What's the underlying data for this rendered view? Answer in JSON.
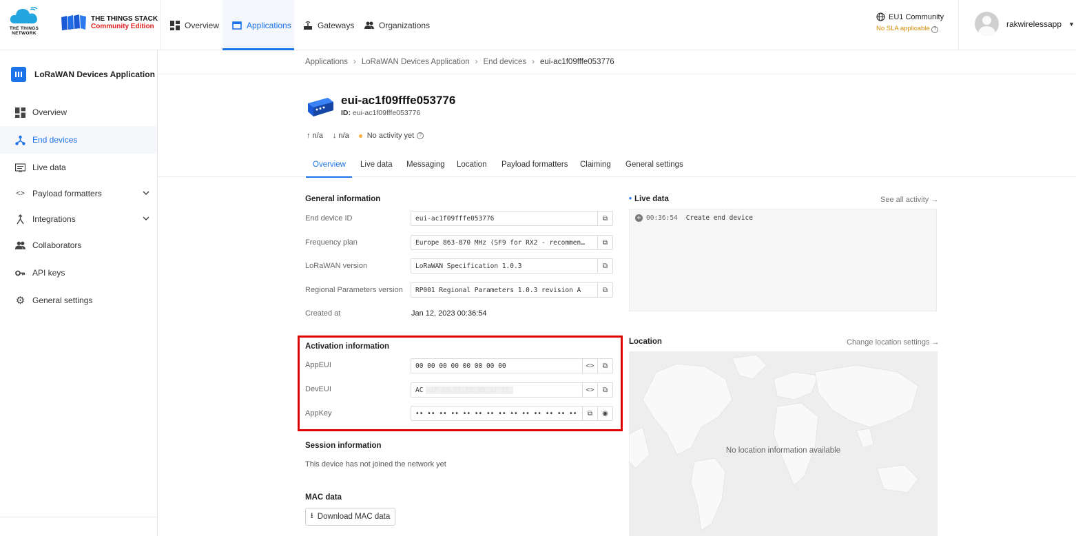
{
  "header": {
    "ttn_logo_text": "THE THINGS NETWORK",
    "tts_logo_line1": "THE THINGS STACK",
    "tts_logo_line2": "Community Edition",
    "nav": [
      {
        "label": "Overview",
        "icon": "dashboard-icon"
      },
      {
        "label": "Applications",
        "icon": "application-icon",
        "active": true
      },
      {
        "label": "Gateways",
        "icon": "gateway-icon"
      },
      {
        "label": "Organizations",
        "icon": "people-icon"
      }
    ],
    "cluster": "EU1 Community",
    "sla": "No SLA applicable",
    "username": "rakwirelessapp"
  },
  "sidebar": {
    "app_title": "LoRaWAN Devices Application",
    "items": [
      {
        "label": "Overview",
        "icon": "dashboard-icon"
      },
      {
        "label": "End devices",
        "icon": "device-hub-icon",
        "active": true
      },
      {
        "label": "Live data",
        "icon": "list-icon"
      },
      {
        "label": "Payload formatters",
        "icon": "code-icon",
        "expandable": true
      },
      {
        "label": "Integrations",
        "icon": "integration-icon",
        "expandable": true
      },
      {
        "label": "Collaborators",
        "icon": "people-icon"
      },
      {
        "label": "API keys",
        "icon": "key-icon"
      },
      {
        "label": "General settings",
        "icon": "gear-icon"
      }
    ]
  },
  "breadcrumb": [
    "Applications",
    "LoRaWAN Devices Application",
    "End devices",
    "eui-ac1f09fffe053776"
  ],
  "device": {
    "title": "eui-ac1f09fffe053776",
    "id_label": "ID:",
    "id_value": "eui-ac1f09fffe053776",
    "uplink": "n/a",
    "downlink": "n/a",
    "activity": "No activity yet"
  },
  "tabs": [
    "Overview",
    "Live data",
    "Messaging",
    "Location",
    "Payload formatters",
    "Claiming",
    "General settings"
  ],
  "general": {
    "title": "General information",
    "fields": [
      {
        "label": "End device ID",
        "value": "eui-ac1f09fffe053776"
      },
      {
        "label": "Frequency plan",
        "value": "Europe 863-870 MHz (SF9 for RX2 - recommen…"
      },
      {
        "label": "LoRaWAN version",
        "value": "LoRaWAN Specification 1.0.3"
      },
      {
        "label": "Regional Parameters version",
        "value": "RP001 Regional Parameters 1.0.3 revision A"
      }
    ],
    "created_label": "Created at",
    "created_value": "Jan 12, 2023 00:36:54"
  },
  "activation": {
    "title": "Activation information",
    "appeui_label": "AppEUI",
    "appeui_value": "00 00 00 00 00 00 00 00",
    "deveui_label": "DevEUI",
    "deveui_value": "AC",
    "deveui_hidden": "1F 09 FF FE 05 37 76",
    "appkey_label": "AppKey",
    "appkey_value": "•• •• •• •• •• •• •• •• •• •• •• •• •• •• •• ••"
  },
  "session": {
    "title": "Session information",
    "text": "This device has not joined the network yet"
  },
  "mac": {
    "title": "MAC data",
    "button": "Download MAC data"
  },
  "live_data": {
    "title": "Live data",
    "see_all": "See all activity →",
    "event_time": "00:36:54",
    "event_text": "Create end device"
  },
  "location": {
    "title": "Location",
    "change": "Change location settings →",
    "empty": "No location information available"
  },
  "colors": {
    "accent": "#1a73e8",
    "highlight": "#e00000",
    "warning": "#d48a00"
  }
}
